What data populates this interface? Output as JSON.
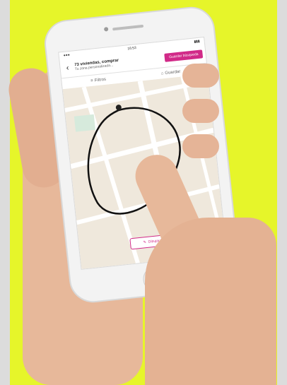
{
  "app": {
    "status_time": "16:53",
    "status_signal": "●●●",
    "status_battery": "▮▮▮",
    "header": {
      "title": "73 viviendas, comprar",
      "subtitle": "Tu zona personalizada...",
      "save_search_label": "Guardar búsqueda"
    },
    "tabs": [
      {
        "label": "Filtros",
        "icon": "filter-icon"
      },
      {
        "label": "Guardar",
        "icon": "save-icon"
      }
    ],
    "map": {
      "draw_zone_label": "Dibujar la zona"
    },
    "colors": {
      "background_yellow": "#e6f52a",
      "accent_pink": "#d12a88",
      "map_base": "#efe8dc",
      "roads": "#ffffff"
    }
  }
}
